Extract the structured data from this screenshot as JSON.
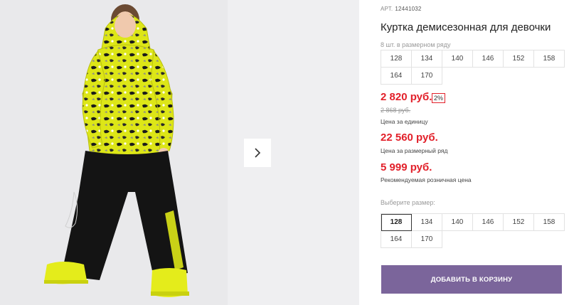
{
  "gallery": {
    "next_icon": "chevron-right-icon"
  },
  "product": {
    "article_label": "АРТ.",
    "article_value": "12441032",
    "title": "Куртка демисезонная для девочки",
    "pack_note": "8 шт. в размерном ряду",
    "pack_sizes": [
      "128",
      "134",
      "140",
      "146",
      "152",
      "158",
      "164",
      "170"
    ]
  },
  "pricing": {
    "unit_price": "2 820 руб.",
    "discount": "2%",
    "old_price": "2 868 руб.",
    "unit_label": "Цена за единицу",
    "row_price": "22 560 руб.",
    "row_label": "Цена за размерный ряд",
    "rrp_price": "5 999 руб.",
    "rrp_label": "Рекомендуемая розничная цена"
  },
  "size_select": {
    "label": "Выберите размер:",
    "selected": "128",
    "options": [
      "128",
      "134",
      "140",
      "146",
      "152",
      "158",
      "164",
      "170"
    ]
  },
  "actions": {
    "add_to_cart": "ДОБАВИТЬ В КОРЗИНУ"
  },
  "colors": {
    "price_red": "#e2202a",
    "button_purple": "#7b659b",
    "jacket_yellow": "#dde617",
    "pants_black": "#141414"
  }
}
